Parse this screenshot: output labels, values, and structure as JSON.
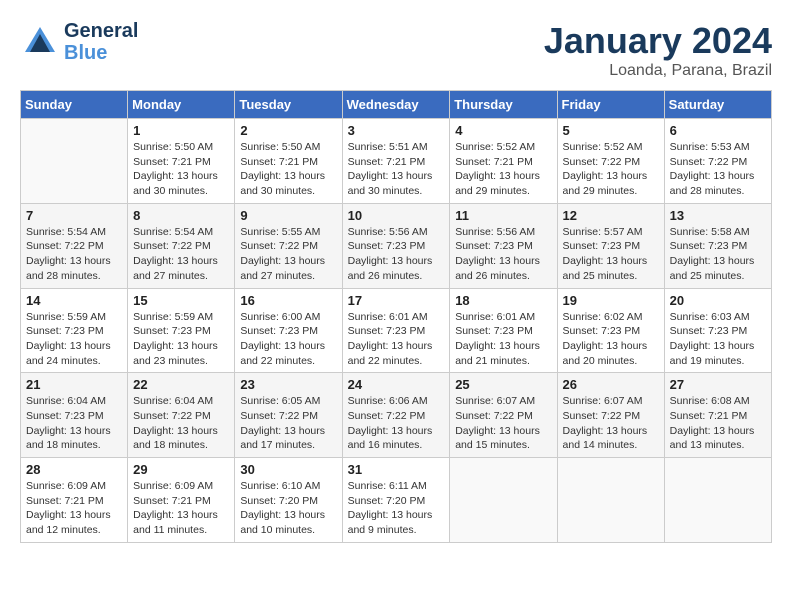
{
  "header": {
    "logo": {
      "general": "General",
      "blue": "Blue"
    },
    "title": "January 2024",
    "location": "Loanda, Parana, Brazil"
  },
  "weekdays": [
    "Sunday",
    "Monday",
    "Tuesday",
    "Wednesday",
    "Thursday",
    "Friday",
    "Saturday"
  ],
  "weeks": [
    [
      {
        "day": "",
        "info": ""
      },
      {
        "day": "1",
        "info": "Sunrise: 5:50 AM\nSunset: 7:21 PM\nDaylight: 13 hours\nand 30 minutes."
      },
      {
        "day": "2",
        "info": "Sunrise: 5:50 AM\nSunset: 7:21 PM\nDaylight: 13 hours\nand 30 minutes."
      },
      {
        "day": "3",
        "info": "Sunrise: 5:51 AM\nSunset: 7:21 PM\nDaylight: 13 hours\nand 30 minutes."
      },
      {
        "day": "4",
        "info": "Sunrise: 5:52 AM\nSunset: 7:21 PM\nDaylight: 13 hours\nand 29 minutes."
      },
      {
        "day": "5",
        "info": "Sunrise: 5:52 AM\nSunset: 7:22 PM\nDaylight: 13 hours\nand 29 minutes."
      },
      {
        "day": "6",
        "info": "Sunrise: 5:53 AM\nSunset: 7:22 PM\nDaylight: 13 hours\nand 28 minutes."
      }
    ],
    [
      {
        "day": "7",
        "info": "Sunrise: 5:54 AM\nSunset: 7:22 PM\nDaylight: 13 hours\nand 28 minutes."
      },
      {
        "day": "8",
        "info": "Sunrise: 5:54 AM\nSunset: 7:22 PM\nDaylight: 13 hours\nand 27 minutes."
      },
      {
        "day": "9",
        "info": "Sunrise: 5:55 AM\nSunset: 7:22 PM\nDaylight: 13 hours\nand 27 minutes."
      },
      {
        "day": "10",
        "info": "Sunrise: 5:56 AM\nSunset: 7:23 PM\nDaylight: 13 hours\nand 26 minutes."
      },
      {
        "day": "11",
        "info": "Sunrise: 5:56 AM\nSunset: 7:23 PM\nDaylight: 13 hours\nand 26 minutes."
      },
      {
        "day": "12",
        "info": "Sunrise: 5:57 AM\nSunset: 7:23 PM\nDaylight: 13 hours\nand 25 minutes."
      },
      {
        "day": "13",
        "info": "Sunrise: 5:58 AM\nSunset: 7:23 PM\nDaylight: 13 hours\nand 25 minutes."
      }
    ],
    [
      {
        "day": "14",
        "info": "Sunrise: 5:59 AM\nSunset: 7:23 PM\nDaylight: 13 hours\nand 24 minutes."
      },
      {
        "day": "15",
        "info": "Sunrise: 5:59 AM\nSunset: 7:23 PM\nDaylight: 13 hours\nand 23 minutes."
      },
      {
        "day": "16",
        "info": "Sunrise: 6:00 AM\nSunset: 7:23 PM\nDaylight: 13 hours\nand 22 minutes."
      },
      {
        "day": "17",
        "info": "Sunrise: 6:01 AM\nSunset: 7:23 PM\nDaylight: 13 hours\nand 22 minutes."
      },
      {
        "day": "18",
        "info": "Sunrise: 6:01 AM\nSunset: 7:23 PM\nDaylight: 13 hours\nand 21 minutes."
      },
      {
        "day": "19",
        "info": "Sunrise: 6:02 AM\nSunset: 7:23 PM\nDaylight: 13 hours\nand 20 minutes."
      },
      {
        "day": "20",
        "info": "Sunrise: 6:03 AM\nSunset: 7:23 PM\nDaylight: 13 hours\nand 19 minutes."
      }
    ],
    [
      {
        "day": "21",
        "info": "Sunrise: 6:04 AM\nSunset: 7:23 PM\nDaylight: 13 hours\nand 18 minutes."
      },
      {
        "day": "22",
        "info": "Sunrise: 6:04 AM\nSunset: 7:22 PM\nDaylight: 13 hours\nand 18 minutes."
      },
      {
        "day": "23",
        "info": "Sunrise: 6:05 AM\nSunset: 7:22 PM\nDaylight: 13 hours\nand 17 minutes."
      },
      {
        "day": "24",
        "info": "Sunrise: 6:06 AM\nSunset: 7:22 PM\nDaylight: 13 hours\nand 16 minutes."
      },
      {
        "day": "25",
        "info": "Sunrise: 6:07 AM\nSunset: 7:22 PM\nDaylight: 13 hours\nand 15 minutes."
      },
      {
        "day": "26",
        "info": "Sunrise: 6:07 AM\nSunset: 7:22 PM\nDaylight: 13 hours\nand 14 minutes."
      },
      {
        "day": "27",
        "info": "Sunrise: 6:08 AM\nSunset: 7:21 PM\nDaylight: 13 hours\nand 13 minutes."
      }
    ],
    [
      {
        "day": "28",
        "info": "Sunrise: 6:09 AM\nSunset: 7:21 PM\nDaylight: 13 hours\nand 12 minutes."
      },
      {
        "day": "29",
        "info": "Sunrise: 6:09 AM\nSunset: 7:21 PM\nDaylight: 13 hours\nand 11 minutes."
      },
      {
        "day": "30",
        "info": "Sunrise: 6:10 AM\nSunset: 7:20 PM\nDaylight: 13 hours\nand 10 minutes."
      },
      {
        "day": "31",
        "info": "Sunrise: 6:11 AM\nSunset: 7:20 PM\nDaylight: 13 hours\nand 9 minutes."
      },
      {
        "day": "",
        "info": ""
      },
      {
        "day": "",
        "info": ""
      },
      {
        "day": "",
        "info": ""
      }
    ]
  ]
}
